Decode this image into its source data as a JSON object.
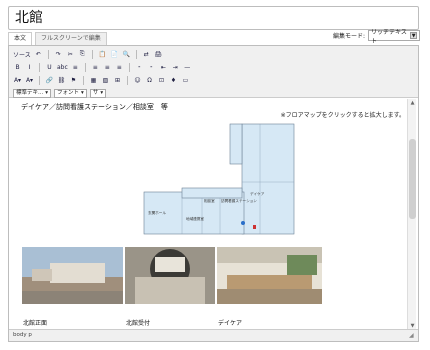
{
  "page_title": "北館",
  "tabs": [
    {
      "label": "本文"
    },
    {
      "label": "フルスクリーンで編集"
    }
  ],
  "edit_mode": {
    "label": "編集モード:",
    "value": "リッチテキスト"
  },
  "toolbar": {
    "row1": [
      "ソース",
      "↶",
      "↷",
      "✂",
      "⎘",
      "📋",
      "📄",
      "🔍",
      "⇄",
      "🖨"
    ],
    "row2": [
      "B",
      "I",
      "U",
      "abc",
      "≡",
      "≡",
      "≡",
      "≡",
      "⁃",
      "⁃",
      "⇤",
      "⇥",
      "—"
    ],
    "row3": [
      "A▾",
      "A▾",
      "🔗",
      "⛓",
      "⚑",
      "▦",
      "▧",
      "⊞",
      "☺",
      "Ω",
      "⊡",
      "♦",
      "▭"
    ],
    "dropdowns": [
      {
        "label": "標準テキ..."
      },
      {
        "label": "フォント"
      },
      {
        "label": "サ"
      }
    ]
  },
  "content": {
    "heading": "デイケア／訪問看護ステーション／相談室　等",
    "note": "※フロアマップをクリックすると拡大します。",
    "map_labels": [
      "デイケア",
      "玄関ホール",
      "訪問看護ステーション",
      "相談室",
      "地域連携室"
    ],
    "photos": [
      {
        "caption": "北館正面",
        "color": "#8fa6bd"
      },
      {
        "caption": "北館受付",
        "color": "#b7b3a8"
      },
      {
        "caption": "デイケア",
        "color": "#d8d2c4"
      }
    ]
  },
  "statusbar": {
    "path": "body  p"
  },
  "colors": {
    "map_fill": "#d6e8f5",
    "map_stroke": "#6b8094",
    "accent": "#1a3c7a"
  }
}
